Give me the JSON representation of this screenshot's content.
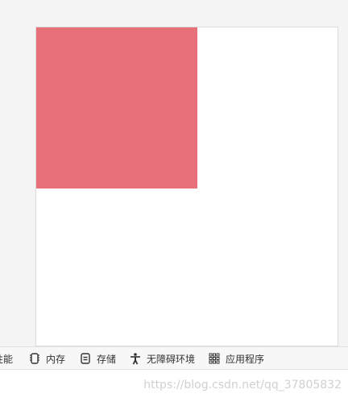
{
  "viewport": {
    "box_color": "#e8707a"
  },
  "devtools_tabs": [
    {
      "label": "性能",
      "icon": "performance-icon"
    },
    {
      "label": "内存",
      "icon": "memory-chip-icon"
    },
    {
      "label": "存储",
      "icon": "storage-icon"
    },
    {
      "label": "无障碍环境",
      "icon": "accessibility-icon"
    },
    {
      "label": "应用程序",
      "icon": "apps-grid-icon"
    }
  ],
  "watermark": {
    "text": "https://blog.csdn.net/qq_37805832"
  }
}
